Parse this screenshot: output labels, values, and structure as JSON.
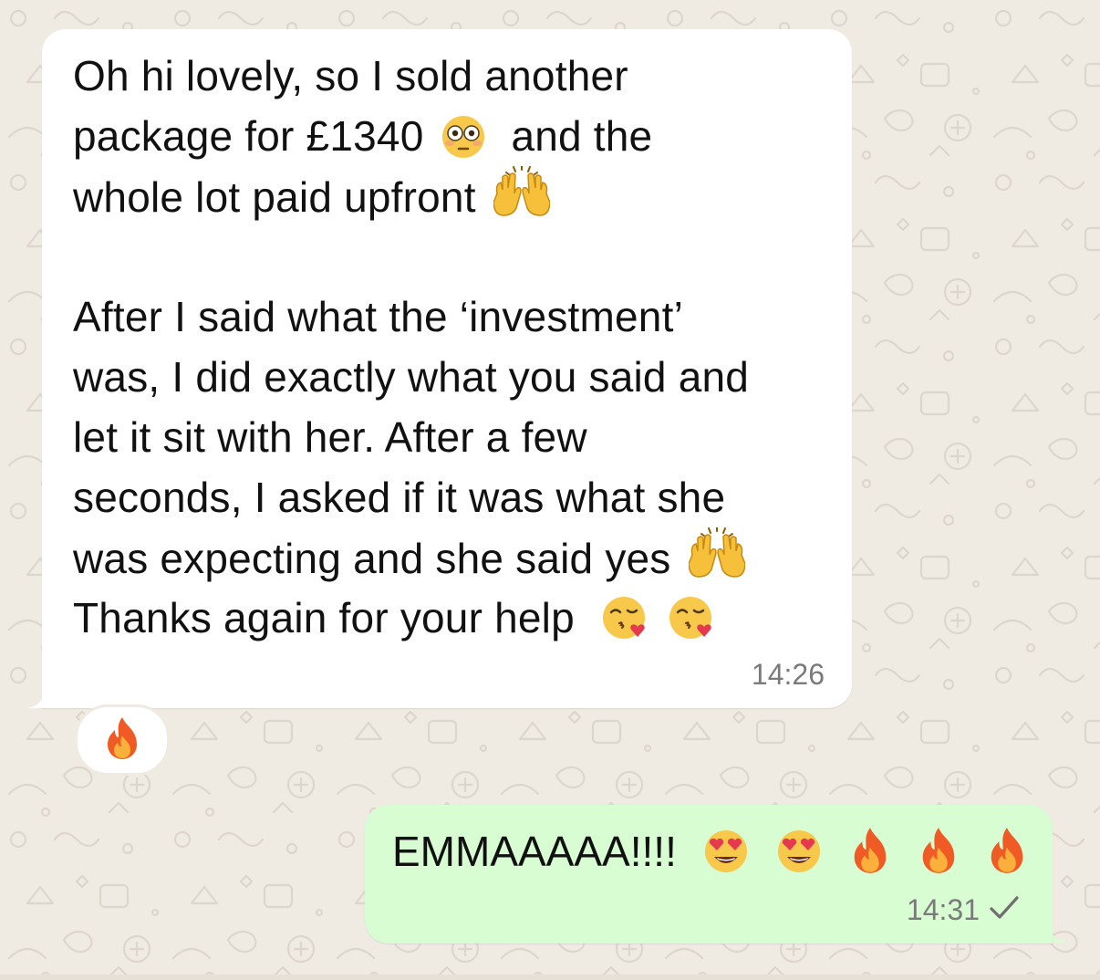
{
  "chat": {
    "incoming": {
      "lines": [
        {
          "text": "Oh hi lovely, so I sold another",
          "emoji": ""
        },
        {
          "text": "package for £1340",
          "emoji": "flushed-face",
          "after": "and the"
        },
        {
          "text": "whole lot paid upfront",
          "emoji": "raising-hands"
        },
        {
          "text": "After I said what the ‘investment’",
          "emoji": ""
        },
        {
          "text": "was, I did exactly what you said and",
          "emoji": ""
        },
        {
          "text": "let it sit with her. After a few",
          "emoji": ""
        },
        {
          "text": "seconds, I asked if it was what she",
          "emoji": ""
        },
        {
          "text": "was expecting and she said yes",
          "emoji": "raising-hands"
        },
        {
          "text": "Thanks again for your help",
          "emoji": "face-blowing-kiss"
        }
      ],
      "time": "14:26",
      "reaction": "fire"
    },
    "outgoing": {
      "text": "EMMAAAAA!!!!",
      "emojis": [
        "smiling-face-with-heart-eyes",
        "smiling-face-with-heart-eyes",
        "fire",
        "fire",
        "fire"
      ],
      "time": "14:31",
      "status": "sent-single-check"
    }
  },
  "colors": {
    "background": "#efeae2",
    "incoming_bubble": "#ffffff",
    "outgoing_bubble": "#d9fdd3",
    "timestamp": "#7a7a7a"
  }
}
